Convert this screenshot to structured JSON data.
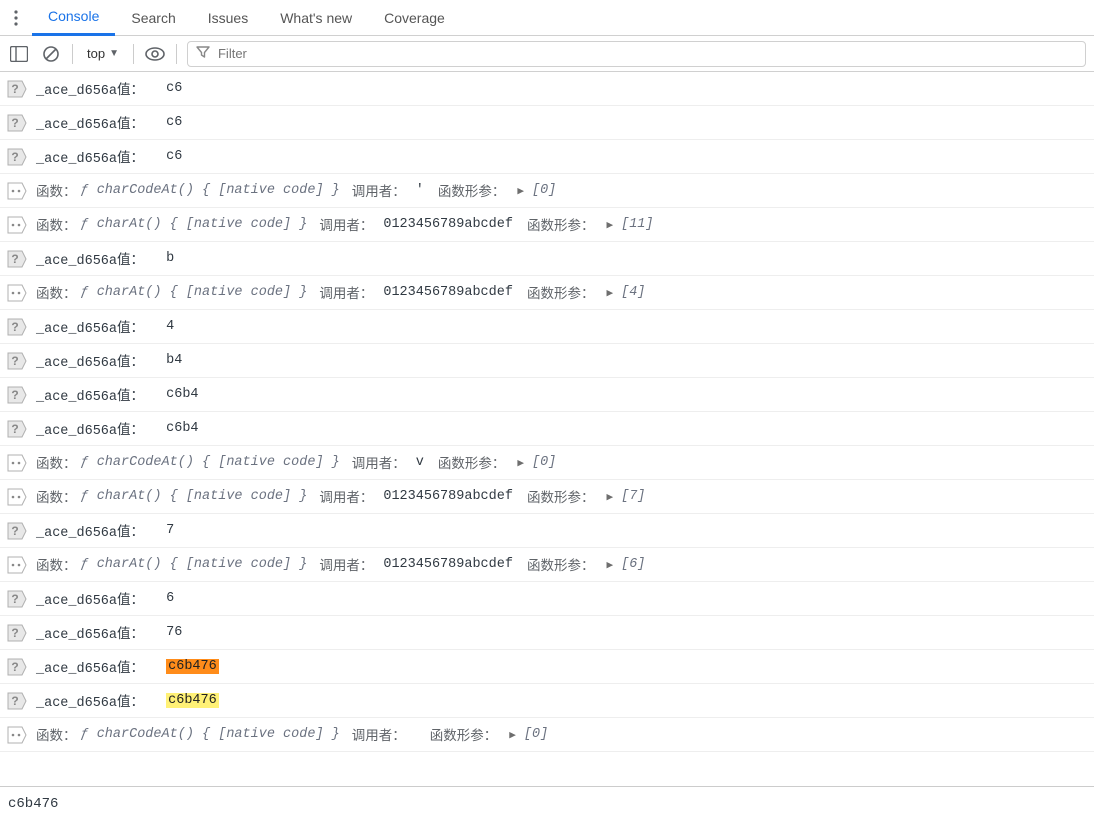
{
  "tabs": {
    "console": "Console",
    "search": "Search",
    "issues": "Issues",
    "whatsnew": "What's new",
    "coverage": "Coverage"
  },
  "toolbar": {
    "context": "top",
    "filter_placeholder": "Filter"
  },
  "labels": {
    "ace": "_ace_d656a值： ",
    "fn": "函数： ",
    "caller": "调用者：",
    "args": "函数形参："
  },
  "fn": {
    "charCodeAt": "ƒ charCodeAt() { [native code] }",
    "charAt": "ƒ charAt() { [native code] }"
  },
  "rows": [
    {
      "type": "ace",
      "value": "c6"
    },
    {
      "type": "ace",
      "value": "c6"
    },
    {
      "type": "ace",
      "value": "c6"
    },
    {
      "type": "func",
      "fn": "charCodeAt",
      "caller": "′",
      "args": "[0]"
    },
    {
      "type": "func",
      "fn": "charAt",
      "caller": "0123456789abcdef",
      "args": "[11]"
    },
    {
      "type": "ace",
      "value": "b"
    },
    {
      "type": "func",
      "fn": "charAt",
      "caller": "0123456789abcdef",
      "args": "[4]"
    },
    {
      "type": "ace",
      "value": "4"
    },
    {
      "type": "ace",
      "value": "b4"
    },
    {
      "type": "ace",
      "value": "c6b4"
    },
    {
      "type": "ace",
      "value": "c6b4"
    },
    {
      "type": "func",
      "fn": "charCodeAt",
      "caller": "v",
      "args": "[0]"
    },
    {
      "type": "func",
      "fn": "charAt",
      "caller": "0123456789abcdef",
      "args": "[7]"
    },
    {
      "type": "ace",
      "value": "7"
    },
    {
      "type": "func",
      "fn": "charAt",
      "caller": "0123456789abcdef",
      "args": "[6]"
    },
    {
      "type": "ace",
      "value": "6"
    },
    {
      "type": "ace",
      "value": "76"
    },
    {
      "type": "ace",
      "value": "c6b476",
      "highlight": "orange"
    },
    {
      "type": "ace",
      "value": "c6b476",
      "highlight": "yellow"
    },
    {
      "type": "func",
      "fn": "charCodeAt",
      "caller": "",
      "args": "[0]"
    }
  ],
  "prompt": "c6b476"
}
